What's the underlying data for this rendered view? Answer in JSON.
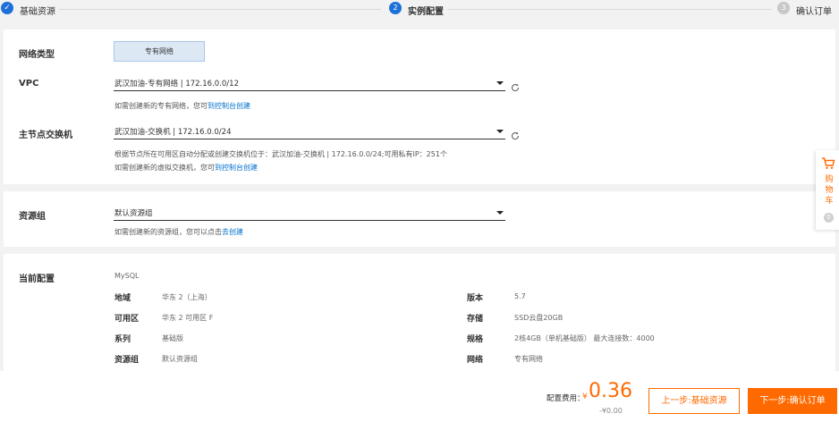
{
  "stepper": {
    "steps": [
      {
        "number": "✓",
        "label": "基础资源",
        "state": "done"
      },
      {
        "number": "2",
        "label": "实例配置",
        "state": "active"
      },
      {
        "number": "3",
        "label": "确认订单",
        "state": "pending"
      }
    ]
  },
  "network": {
    "type_label": "网络类型",
    "type_option": "专有网络",
    "vpc_label": "VPC",
    "vpc_value": "武汉加油-专有网络 | 172.16.0.0/12",
    "vpc_hint": "如需创建新的专有网络，您可",
    "vpc_hint_link": "到控制台创建",
    "vswitch_label": "主节点交换机",
    "vswitch_value": "武汉加油-交换机 | 172.16.0.0/24",
    "vswitch_info": "根据节点所在可用区自动分配或创建交换机位于：武汉加油-交换机 | 172.16.0.0/24;可用私有IP：251个",
    "vswitch_hint": "如需创建新的虚拟交换机，您可",
    "vswitch_hint_link": "到控制台创建"
  },
  "resource_group": {
    "label": "资源组",
    "value": "默认资源组",
    "hint": "如需创建新的资源组，您可以点击",
    "hint_link": "去创建"
  },
  "current_config": {
    "label": "当前配置",
    "engine": "MySQL",
    "left": [
      {
        "key": "地域",
        "value": "华东 2（上海）"
      },
      {
        "key": "可用区",
        "value": "华东 2 可用区 F"
      },
      {
        "key": "系列",
        "value": "基础版"
      },
      {
        "key": "资源组",
        "value": "默认资源组"
      }
    ],
    "right": [
      {
        "key": "版本",
        "value": "5.7"
      },
      {
        "key": "存储",
        "value": "SSD云盘20GB"
      },
      {
        "key": "规格",
        "value": "2核4GB（单机基础版） 最大连接数：4000"
      },
      {
        "key": "网络",
        "value": "专有网络"
      }
    ]
  },
  "cart": {
    "label": "购物车",
    "count": "0"
  },
  "footer": {
    "fee_label": "配置费用：",
    "currency": "¥",
    "fee_value": "0.36",
    "fee_sub": "-¥0.00",
    "prev_button": "上一步:基础资源",
    "next_button": "下一步:确认订单"
  },
  "colors": {
    "accent": "#ff6a00",
    "primary_blue": "#1e6fd9",
    "link": "#0070cc"
  }
}
